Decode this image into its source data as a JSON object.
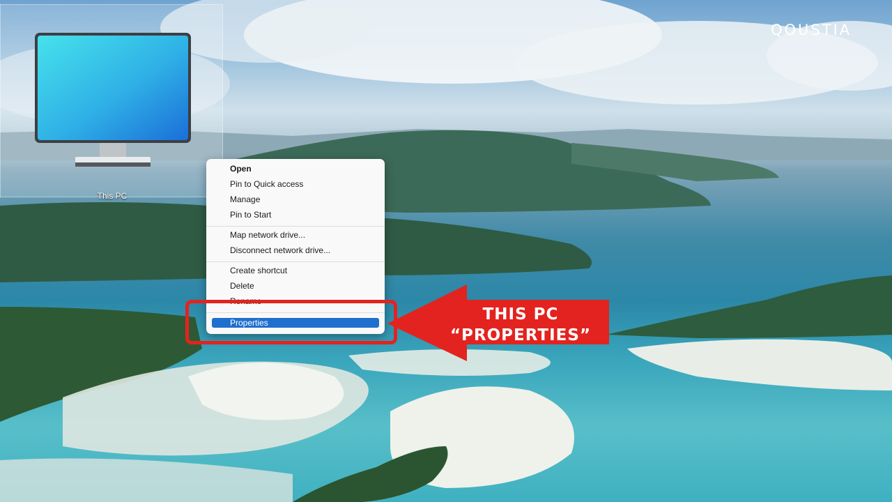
{
  "brand": "QOUSTIA",
  "desktop_icon": {
    "label": "This PC"
  },
  "context_menu": {
    "groups": [
      [
        "Open",
        "Pin to Quick access",
        "Manage",
        "Pin to Start"
      ],
      [
        "Map network drive...",
        "Disconnect network drive..."
      ],
      [
        "Create shortcut",
        "Delete",
        "Rename"
      ],
      [
        "Properties"
      ]
    ],
    "selected": "Properties"
  },
  "callout": {
    "line1": "THIS PC",
    "line2": "“PROPERTIES”"
  },
  "colors": {
    "highlight": "#e3231f",
    "menu_selection": "#1f6fce",
    "monitor_screen": "#2fb0e6"
  }
}
